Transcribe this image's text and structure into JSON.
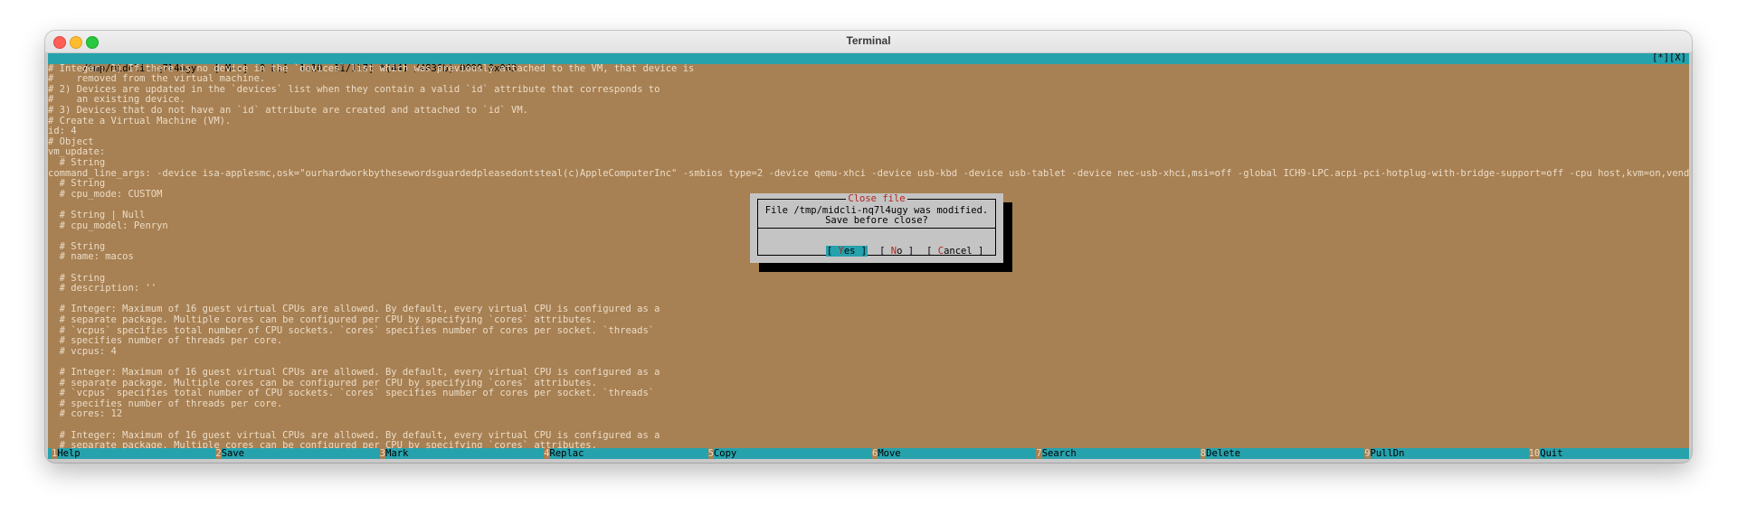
{
  "window": {
    "title": "Terminal"
  },
  "status": {
    "left": "/tmp/midcli-nq7l4ugy   [-M--]  0 L:[  1+10  11/117] *(441 /4836b) 0099 0x063",
    "right": "[*][X]"
  },
  "lines": [
    "# Integer: 1) If there is no device in the `devices` list which was previously attached to the VM, that device is",
    "#    removed from the virtual machine.",
    "# 2) Devices are updated in the `devices` list when they contain a valid `id` attribute that corresponds to",
    "#    an existing device.",
    "# 3) Devices that do not have an `id` attribute are created and attached to `id` VM.",
    "# Create a Virtual Machine (VM).",
    "id: 4",
    "# Object",
    "vm_update:",
    "  # String",
    "command_line_args: -device isa-applesmc,osk=\"ourhardworkbythesewordsguardedpleasedontsteal(c)AppleComputerInc\" -smbios type=2 -device qemu-xhci -device usb-kbd -device usb-tablet -device nec-usb-xhci,msi=off -global ICH9-LPC.acpi-pci-hotplug-with-bridge-support=off -cpu host,kvm=on,vendor=GenuineIntel,+kvm_pv_",
    "  # String",
    "  # cpu_mode: CUSTOM",
    "",
    "  # String | Null",
    "  # cpu_model: Penryn",
    "",
    "  # String",
    "  # name: macos",
    "",
    "  # String",
    "  # description: ''",
    "",
    "  # Integer: Maximum of 16 guest virtual CPUs are allowed. By default, every virtual CPU is configured as a",
    "  # separate package. Multiple cores can be configured per CPU by specifying `cores` attributes.",
    "  # `vcpus` specifies total number of CPU sockets. `cores` specifies number of cores per socket. `threads`",
    "  # specifies number of threads per core.",
    "  # vcpus: 4",
    "",
    "  # Integer: Maximum of 16 guest virtual CPUs are allowed. By default, every virtual CPU is configured as a",
    "  # separate package. Multiple cores can be configured per CPU by specifying `cores` attributes.",
    "  # `vcpus` specifies total number of CPU sockets. `cores` specifies number of cores per socket. `threads`",
    "  # specifies number of threads per core.",
    "  # cores: 12",
    "",
    "  # Integer: Maximum of 16 guest virtual CPUs are allowed. By default, every virtual CPU is configured as a",
    "  # separate package. Multiple cores can be configured per CPU by specifying `cores` attributes."
  ],
  "dialog": {
    "title": "Close file",
    "message_line1": "File /tmp/midcli-nq7l4ugy was modified.",
    "message_line2": "Save before close?",
    "buttons": [
      {
        "pre": "[ ",
        "hot": "Y",
        "rest": "es ]"
      },
      {
        "pre": "[ ",
        "hot": "N",
        "rest": "o ]"
      },
      {
        "pre": "[ ",
        "hot": "C",
        "rest": "ancel ]"
      }
    ]
  },
  "fkeys": [
    {
      "num": "1",
      "label": "Help"
    },
    {
      "num": "2",
      "label": "Save"
    },
    {
      "num": "3",
      "label": "Mark"
    },
    {
      "num": "4",
      "label": "Replac"
    },
    {
      "num": "5",
      "label": "Copy"
    },
    {
      "num": "6",
      "label": "Move"
    },
    {
      "num": "7",
      "label": "Search"
    },
    {
      "num": "8",
      "label": "Delete"
    },
    {
      "num": "9",
      "label": "PullDn"
    },
    {
      "num": "10",
      "label": "Quit"
    }
  ],
  "colors": {
    "background": "#a78053",
    "text": "#ecdcc6",
    "bar": "#26a2ad",
    "dialog": "#c4c4c4",
    "hotkey": "#b3261e"
  }
}
